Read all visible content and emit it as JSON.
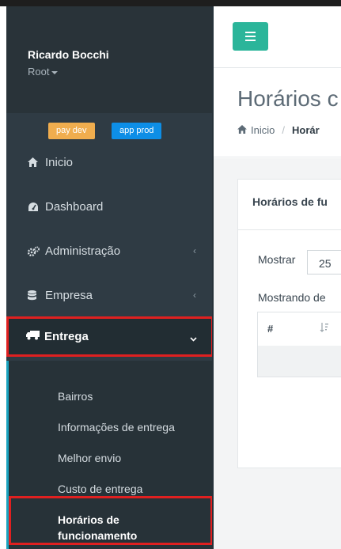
{
  "user": {
    "name": "Ricardo Bocchi",
    "role": "Root"
  },
  "badges": {
    "dev": "pay dev",
    "prod": "app prod"
  },
  "sidebar": {
    "items": [
      {
        "label": "Inicio",
        "icon": "home-icon"
      },
      {
        "label": "Dashboard",
        "icon": "dashboard-icon"
      },
      {
        "label": "Administração",
        "icon": "cogs-icon"
      },
      {
        "label": "Empresa",
        "icon": "database-icon"
      },
      {
        "label": "Entrega",
        "icon": "truck-icon"
      }
    ],
    "submenu": [
      "Bairros",
      "Informações de entrega",
      "Melhor envio",
      "Custo de entrega",
      "Horários de funcionamento"
    ],
    "submenu_selected_line1": "Horários de",
    "submenu_selected_line2": "funcionamento"
  },
  "header": {
    "title": "Horários c",
    "breadcrumb_home": "Inicio",
    "breadcrumb_current": "Horár"
  },
  "card": {
    "title": "Horários de fu",
    "show_label": "Mostrar",
    "page_size": "25",
    "info": "Mostrando de",
    "table_headers": [
      "#"
    ]
  },
  "colors": {
    "sidebar_bg": "#2f3b44",
    "accent_green": "#2bb59a",
    "highlight_red": "#e02020",
    "badge_dev": "#f0ad4e",
    "badge_prod": "#0d8ee6"
  }
}
